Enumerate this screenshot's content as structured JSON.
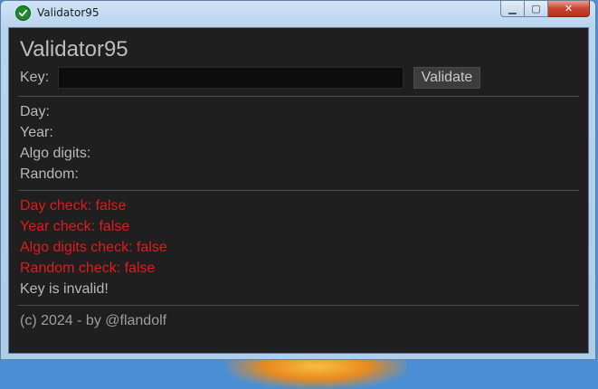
{
  "window": {
    "title": "Validator95",
    "controls": {
      "minimize": "▁",
      "maximize": "▢",
      "close": "✕"
    }
  },
  "app": {
    "heading": "Validator95",
    "key_label": "Key:",
    "key_value": "",
    "validate_label": "Validate"
  },
  "fields": [
    {
      "label": "Day:"
    },
    {
      "label": "Year:"
    },
    {
      "label": "Algo digits:"
    },
    {
      "label": "Random:"
    }
  ],
  "checks": [
    {
      "text": "Day check: false",
      "status": "fail"
    },
    {
      "text": "Year check: false",
      "status": "fail"
    },
    {
      "text": "Algo digits check: false",
      "status": "fail"
    },
    {
      "text": "Random check: false",
      "status": "fail"
    }
  ],
  "result": "Key is invalid!",
  "footer": "(c) 2024 - by @flandolf",
  "colors": {
    "fail": "#e01b1b",
    "background": "#1f1f1f",
    "text": "#b8b8b8",
    "icon": "#1f8a2a"
  },
  "icons": {
    "app": "check-circle-icon"
  }
}
